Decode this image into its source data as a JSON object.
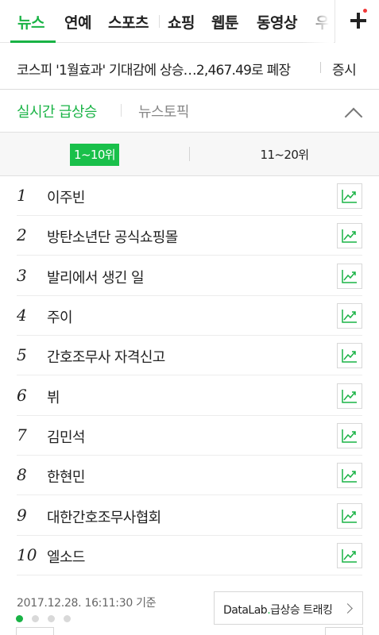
{
  "top_nav": {
    "tabs": [
      {
        "label": "뉴스",
        "active": true
      },
      {
        "label": "연예",
        "active": false
      },
      {
        "label": "스포츠",
        "active": false
      },
      {
        "label": "쇼핑",
        "active": false
      },
      {
        "label": "웹툰",
        "active": false
      },
      {
        "label": "동영상",
        "active": false
      },
      {
        "label": "우",
        "active": false
      }
    ],
    "plus_icon": "plus-icon",
    "notification_color": "#f03838"
  },
  "ticker": {
    "headline": "코스피 '1월효과' 기대감에 상승…2,467.49로 폐장",
    "category": "증시"
  },
  "section": {
    "realtime_title": "실시간 급상승",
    "topic_title": "뉴스토픽",
    "collapse_icon": "chevron-up-icon"
  },
  "range_tabs": {
    "first": "1~10위",
    "second": "11~20위",
    "active": "first"
  },
  "rankings": [
    {
      "rank": "1",
      "keyword": "이주빈"
    },
    {
      "rank": "2",
      "keyword": "방탄소년단 공식쇼핑몰"
    },
    {
      "rank": "3",
      "keyword": "발리에서 생긴 일"
    },
    {
      "rank": "4",
      "keyword": "주이"
    },
    {
      "rank": "5",
      "keyword": "간호조무사 자격신고"
    },
    {
      "rank": "6",
      "keyword": "뷔"
    },
    {
      "rank": "7",
      "keyword": "김민석"
    },
    {
      "rank": "8",
      "keyword": "한현민"
    },
    {
      "rank": "9",
      "keyword": "대한간호조무사협회"
    },
    {
      "rank": "10",
      "keyword": "엘소드"
    }
  ],
  "footer": {
    "timestamp": "2017.12.28. 16:11:30 기준",
    "datalab_prefix": "DataLab",
    "datalab_dot": ".",
    "datalab_suffix": "급상승 트래킹"
  },
  "pager": {
    "count": 4,
    "active_index": 0
  },
  "colors": {
    "accent": "#19b345",
    "active_range_bg": "#19c04a"
  }
}
